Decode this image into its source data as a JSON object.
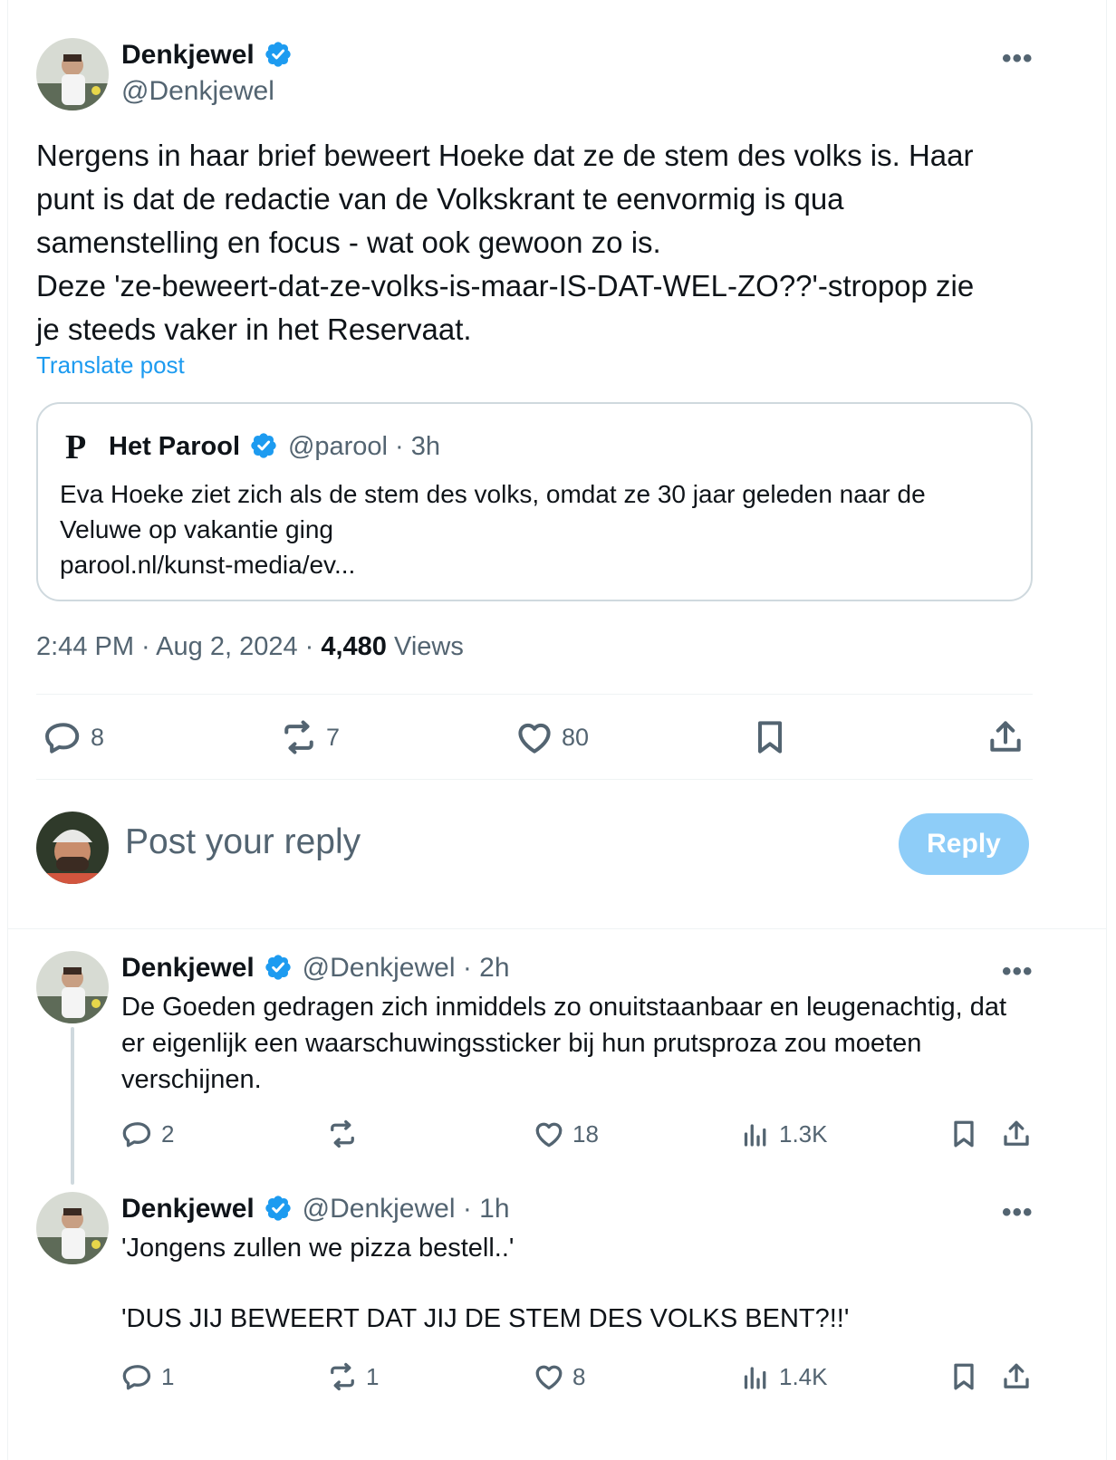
{
  "main_post": {
    "display_name": "Denkjewel",
    "handle": "@Denkjewel",
    "more_label": "•••",
    "text_lines": [
      "Nergens in haar brief beweert Hoeke dat ze de stem des volks is. Haar",
      "punt is dat de redactie van de Volkskrant te eenvormig is qua",
      "samenstelling en focus - wat ook gewoon zo is.",
      "Deze 'ze-beweert-dat-ze-volks-is-maar-IS-DAT-WEL-ZO??'-stropop zie",
      "je steeds vaker in het Reservaat."
    ],
    "translate_label": "Translate post",
    "quote": {
      "logo_letter": "P",
      "display_name": "Het Parool",
      "handle_time": "@parool · 3h",
      "text_lines": [
        "Eva Hoeke ziet zich als de stem des volks, omdat ze 30 jaar geleden naar de",
        "Veluwe op vakantie ging"
      ],
      "link": "parool.nl/kunst-media/ev..."
    },
    "timestamp": "2:44 PM · Aug 2, 2024 · ",
    "views_count": "4,480",
    "views_label": " Views",
    "stats": {
      "replies": "8",
      "reposts": "7",
      "likes": "80"
    }
  },
  "compose": {
    "placeholder": "Post your reply",
    "reply_button": "Reply"
  },
  "replies": [
    {
      "display_name": "Denkjewel",
      "handle_time": "@Denkjewel · 2h",
      "more_label": "•••",
      "text_lines": [
        "De Goeden gedragen zich inmiddels zo onuitstaanbaar en leugenachtig, dat",
        "er eigenlijk een waarschuwingssticker bij hun prutsproza zou moeten",
        "verschijnen."
      ],
      "replies": "2",
      "reposts": "",
      "likes": "18",
      "views": "1.3K"
    },
    {
      "display_name": "Denkjewel",
      "handle_time": "@Denkjewel · 1h",
      "more_label": "•••",
      "text_lines": [
        "'Jongens zullen we pizza bestell..'",
        "",
        "'DUS JIJ BEWEERT DAT JIJ DE STEM DES VOLKS BENT?!!'"
      ],
      "replies": "1",
      "reposts": "1",
      "likes": "8",
      "views": "1.4K"
    }
  ],
  "colors": {
    "verified": "#1d9bf0",
    "link": "#1d9bf0",
    "reply_button_disabled": "#8ecdf8",
    "secondary_text": "#536471"
  }
}
